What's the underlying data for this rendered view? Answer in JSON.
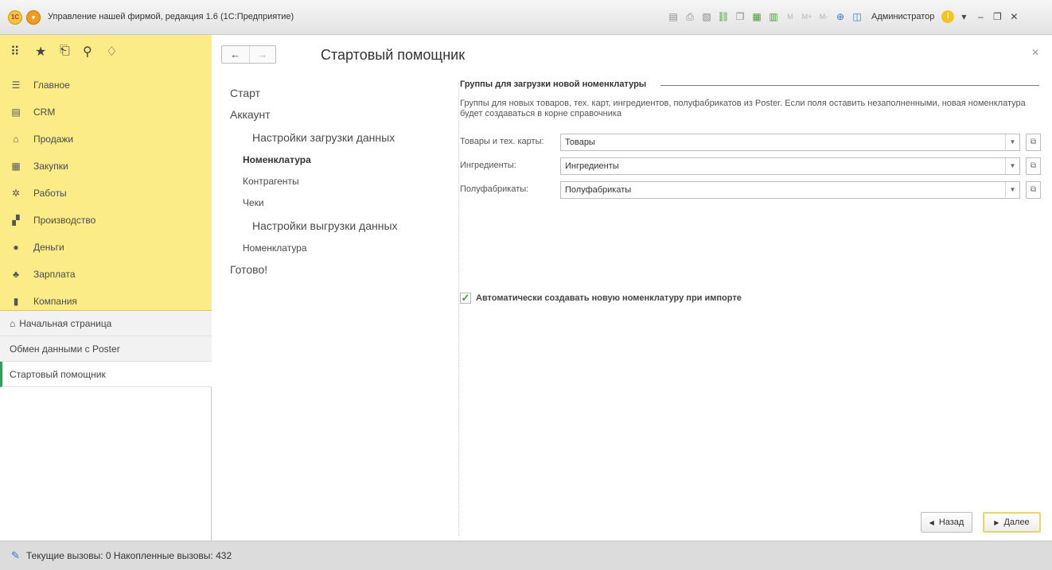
{
  "window": {
    "logo": "1C",
    "title": "Управление нашей фирмой, редакция 1.6  (1С:Предприятие)",
    "user": "Администратор"
  },
  "sidebar": {
    "nav": [
      {
        "label": "Главное",
        "icon": "☰"
      },
      {
        "label": "CRM",
        "icon": "▤"
      },
      {
        "label": "Продажи",
        "icon": "⌂"
      },
      {
        "label": "Закупки",
        "icon": "▦"
      },
      {
        "label": "Работы",
        "icon": "✲"
      },
      {
        "label": "Производство",
        "icon": "▞"
      },
      {
        "label": "Деньги",
        "icon": "●"
      },
      {
        "label": "Зарплата",
        "icon": "♣"
      },
      {
        "label": "Компания",
        "icon": "▮"
      }
    ],
    "open_windows": [
      {
        "label": "Начальная страница"
      },
      {
        "label": "Обмен данными с Poster"
      },
      {
        "label": "Стартовый помощник"
      }
    ]
  },
  "form": {
    "title": "Стартовый помощник",
    "steps": [
      "Старт",
      "Аккаунт",
      "Настройки загрузки данных",
      "Номенклатура",
      "Контрагенты",
      "Чеки",
      "Настройки выгрузки данных",
      "Номенклатура",
      "Готово!"
    ],
    "group_title": "Группы для загрузки новой номенклатуры",
    "description": "Группы для новых товаров, тех. карт, ингредиентов, полуфабрикатов из Poster. Если поля оставить незаполненными, новая номенклатура будет создаваться в корне справочника",
    "fields": [
      {
        "label": "Товары и тех. карты:",
        "value": "Товары"
      },
      {
        "label": "Ингредиенты:",
        "value": "Ингредиенты"
      },
      {
        "label": "Полуфабрикаты:",
        "value": "Полуфабрикаты"
      }
    ],
    "checkbox": {
      "label": "Автоматически создавать новую номенклатуру при импорте",
      "checked": true
    },
    "buttons": {
      "back": "Назад",
      "next": "Далее"
    }
  },
  "status": {
    "text": "Текущие вызовы: 0   Накопленные вызовы: 432"
  }
}
